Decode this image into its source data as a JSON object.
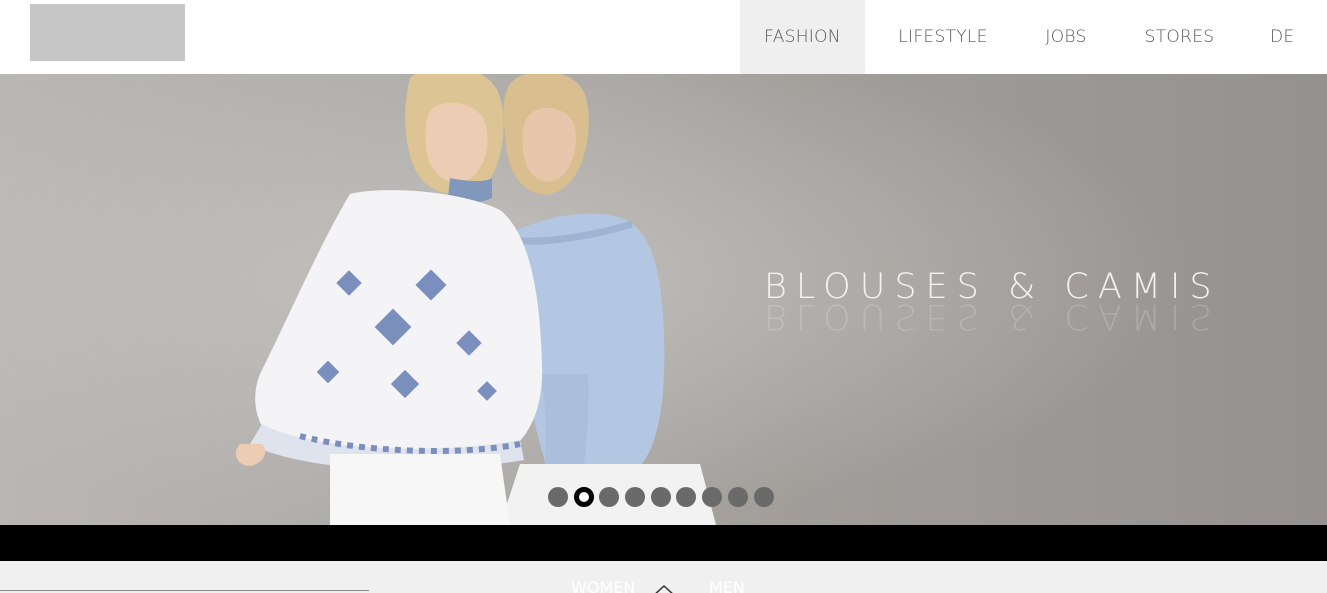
{
  "nav": {
    "items": [
      {
        "label": "FASHION",
        "active": true
      },
      {
        "label": "LIFESTYLE",
        "active": false
      },
      {
        "label": "JOBS",
        "active": false
      },
      {
        "label": "STORES",
        "active": false
      },
      {
        "label": "DE",
        "active": false
      }
    ]
  },
  "hero": {
    "caption": "BLOUSES & CAMIS",
    "slides_total": 9,
    "active_slide": 2
  },
  "bottom": {
    "women_label": "WOMEN",
    "men_label": "MEN",
    "toggle_icon": "chevron-up-icon"
  },
  "colors": {
    "nav_active_bg": "#efefef",
    "black_bar": "#000000",
    "section_bg": "#f0f0f0"
  }
}
